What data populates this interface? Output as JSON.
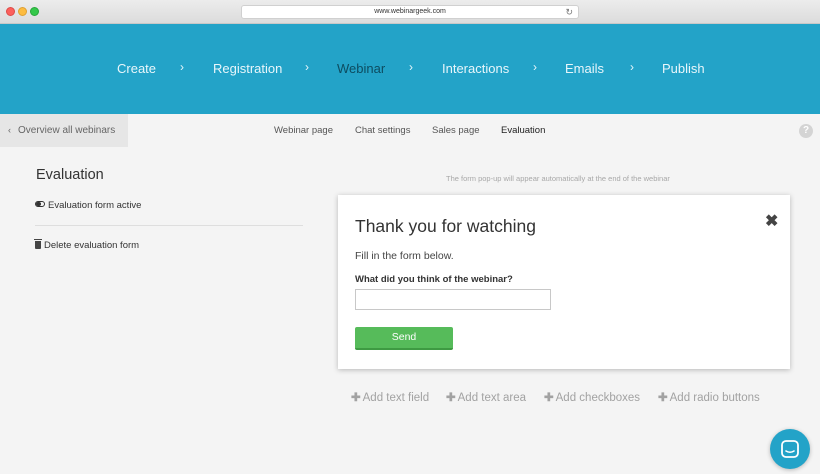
{
  "browser": {
    "url": "www.webinargeek.com",
    "reload_icon": "reload-icon"
  },
  "steps": {
    "create": "Create",
    "registration": "Registration",
    "webinar": "Webinar",
    "interactions": "Interactions",
    "emails": "Emails",
    "publish": "Publish",
    "separator": "›",
    "active": "Webinar"
  },
  "subnav": {
    "back_label": "Overview all webinars",
    "back_icon": "chevron-left-icon",
    "tabs": {
      "webinar_page": "Webinar page",
      "chat_settings": "Chat settings",
      "sales_page": "Sales page",
      "evaluation": "Evaluation"
    },
    "active_tab": "Evaluation",
    "help_glyph": "?"
  },
  "panel": {
    "title": "Evaluation",
    "toggle_label": "Evaluation form active",
    "toggle_state": "on",
    "delete_label": "Delete evaluation form"
  },
  "form": {
    "hint": "The form pop-up will appear automatically at the end of the webinar",
    "title": "Thank you for watching",
    "close_glyph": "✖",
    "subtitle": "Fill in the form below.",
    "question": "What did you think of the webinar?",
    "answer_value": "",
    "send_label": "Send"
  },
  "add_fields": {
    "plus": "✚",
    "text_field": "Add text field",
    "text_area": "Add text area",
    "checkboxes": "Add checkboxes",
    "radio_buttons": "Add radio buttons"
  },
  "colors": {
    "banner": "#23a3c8",
    "active_step": "#0d4c60",
    "send_button": "#56bb5a"
  }
}
